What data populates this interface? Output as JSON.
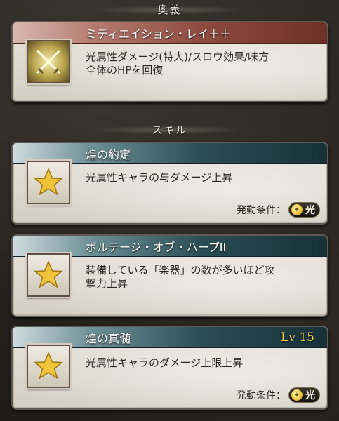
{
  "ougi_section": {
    "title": "奥義"
  },
  "ougi": {
    "name": "ミディエイション・レイ＋＋",
    "desc_line1": "光属性ダメージ(特大)/スロウ効果/味方",
    "desc_line2": "全体のHPを回復",
    "icon": "crossed-swords-icon"
  },
  "skill_section": {
    "title": "スキル"
  },
  "skills": [
    {
      "name": "煌の約定",
      "desc_line1": "光属性キャラの与ダメージ上昇",
      "desc_line2": "",
      "condition_label": "発動条件：",
      "condition_badge": "光",
      "icon": "star-icon"
    },
    {
      "name": "ボルテージ・オブ・ハープII",
      "desc_line1": "装備している「楽器」の数が多いほど攻",
      "desc_line2": "撃力上昇",
      "icon": "star-icon"
    },
    {
      "name": "煌の真髄",
      "level": "Lv 15",
      "desc_line1": "光属性キャラのダメージ上限上昇",
      "desc_line2": "",
      "condition_label": "発動条件：",
      "condition_badge": "光",
      "icon": "star-icon"
    }
  ],
  "colors": {
    "ougi_title": "#8e4b40",
    "skill_title": "#2b4d55",
    "level_text": "#f5d74a",
    "element_light": "#e8c23a"
  }
}
